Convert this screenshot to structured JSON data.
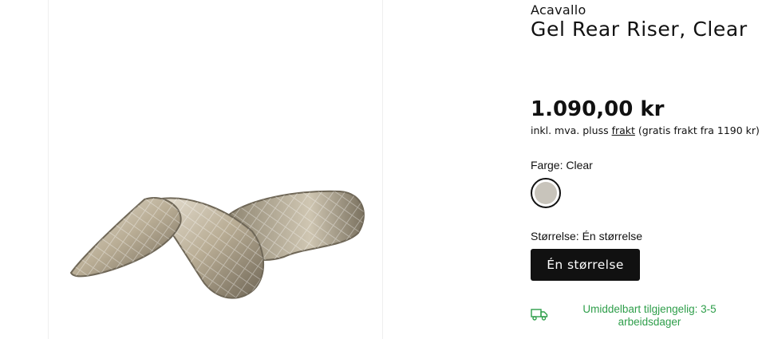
{
  "product": {
    "brand": "Acavallo",
    "title": "Gel Rear Riser, Clear",
    "price": "1.090,00 kr",
    "tax_prefix": "inkl. mva. pluss",
    "shipping_link": "frakt",
    "tax_suffix": "(gratis frakt fra 1190 kr)",
    "image_icon": "gel-riser-image"
  },
  "color": {
    "label": "Farge: Clear",
    "swatch_color": "#c8c4bb"
  },
  "size": {
    "label": "Størrelse: Én størrelse",
    "button_label": "Én størrelse"
  },
  "availability": {
    "icon": "truck-icon",
    "text": "Umiddelbart tilgjengelig: 3-5 arbeidsdager",
    "color": "#2e9e4a"
  }
}
